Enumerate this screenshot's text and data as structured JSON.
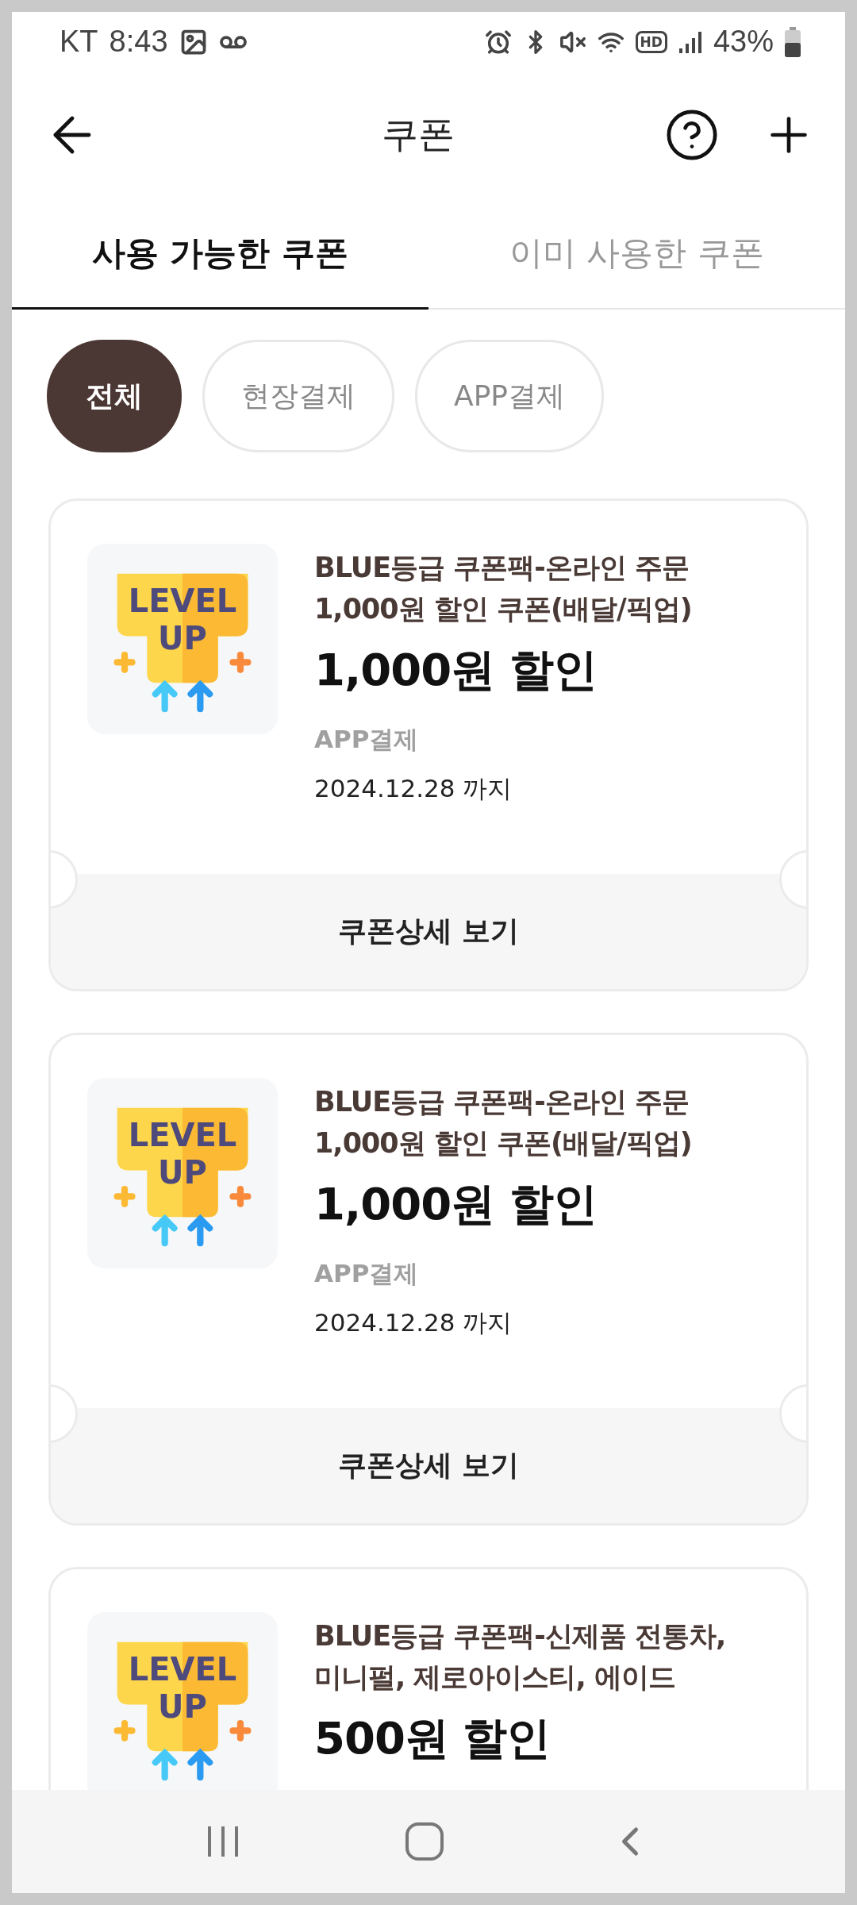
{
  "status_bar": {
    "carrier": "KT",
    "time": "8:43",
    "hd_label": "HD",
    "battery": "43%"
  },
  "header": {
    "title": "쿠폰"
  },
  "tabs": [
    {
      "label": "사용 가능한 쿠폰",
      "selected": true
    },
    {
      "label": "이미 사용한 쿠폰",
      "selected": false
    }
  ],
  "filters": [
    {
      "label": "전체",
      "selected": true
    },
    {
      "label": "현장결제",
      "selected": false
    },
    {
      "label": "APP결제",
      "selected": false
    }
  ],
  "coupons": [
    {
      "badge": [
        "LEVEL",
        "UP"
      ],
      "title": "BLUE등급 쿠폰팩-온라인 주문\n1,000원 할인 쿠폰(배달/픽업)",
      "discount": "1,000원 할인",
      "payment": "APP결제",
      "expiry": "2024.12.28 까지",
      "detail_button": "쿠폰상세 보기"
    },
    {
      "badge": [
        "LEVEL",
        "UP"
      ],
      "title": "BLUE등급 쿠폰팩-온라인 주문\n1,000원 할인 쿠폰(배달/픽업)",
      "discount": "1,000원 할인",
      "payment": "APP결제",
      "expiry": "2024.12.28 까지",
      "detail_button": "쿠폰상세 보기"
    },
    {
      "badge": [
        "LEVEL",
        "UP"
      ],
      "title": "BLUE등급 쿠폰팩-신제품 전통차,\n미니펄, 제로아이스티, 에이드",
      "discount": "500원 할인"
    }
  ]
}
